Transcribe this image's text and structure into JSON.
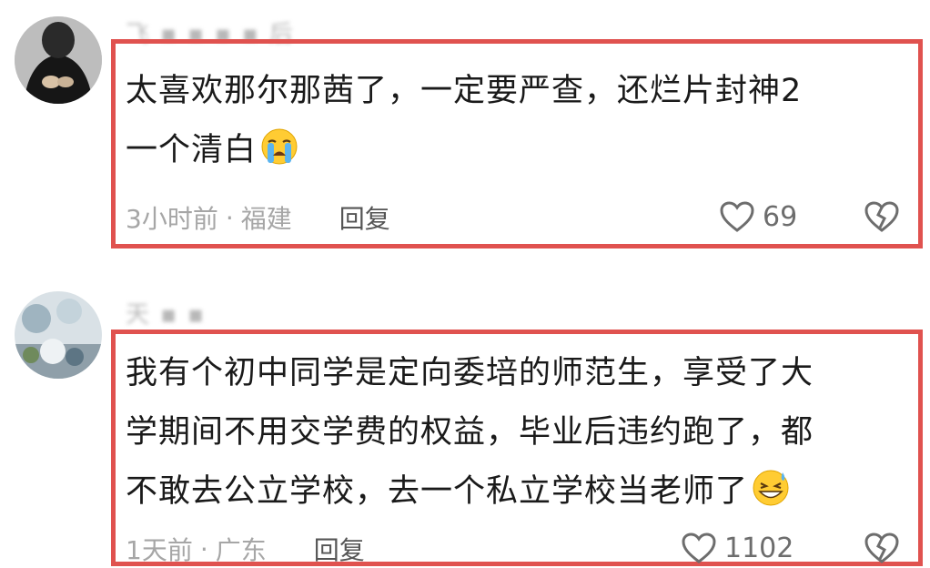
{
  "comments": [
    {
      "username": "飞 ▪ ▪ ▪ ▪ 后",
      "text_lines": [
        "太喜欢那尔那茜了，一定要严查，还烂片封神2",
        "一个清白"
      ],
      "emoji": "loudly-crying-face",
      "time": "3小时前",
      "separator": "·",
      "location": "福建",
      "reply_label": "回复",
      "like_count": "69",
      "highlight_color": "#e0524f"
    },
    {
      "username": "天 ▪ ▪",
      "text_lines": [
        "我有个初中同学是定向委培的师范生，享受了大",
        "学期间不用交学费的权益，毕业后违约跑了，都",
        "不敢去公立学校，去一个私立学校当老师了"
      ],
      "emoji": "grinning-face-with-sweat",
      "time": "1天前",
      "separator": "·",
      "location": "广东",
      "reply_label": "回复",
      "like_count": "1102"
    }
  ]
}
